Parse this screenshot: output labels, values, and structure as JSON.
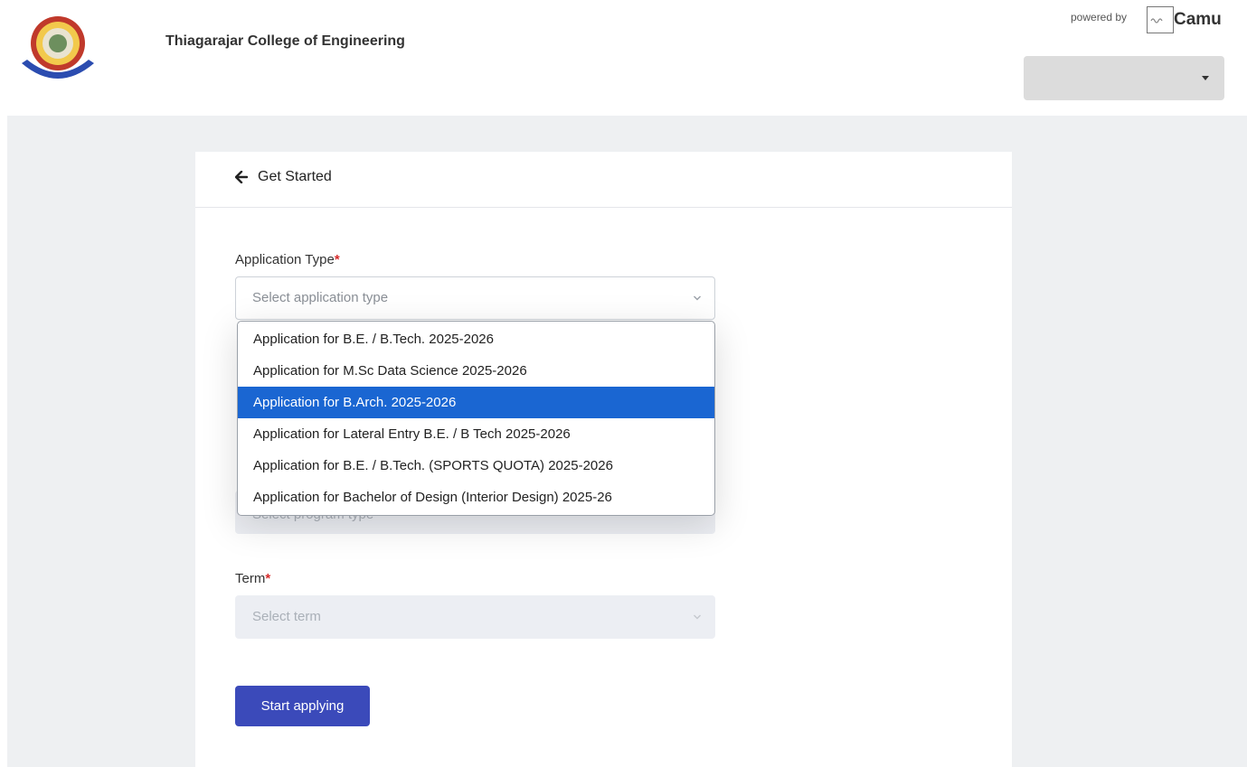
{
  "header": {
    "college_name": "Thiagarajar College of Engineering",
    "logo_icon": "college-emblem-icon",
    "powered_by": "powered by",
    "brand": "Camu",
    "brand_icon": "mycamu-logo-icon",
    "language_select": {
      "value": "",
      "icon": "caret-down-icon"
    }
  },
  "page": {
    "back_icon": "arrow-left-icon",
    "back_label": "Get Started"
  },
  "form": {
    "application_type": {
      "label": "Application Type",
      "required_mark": "*",
      "placeholder": "Select application type",
      "options": [
        "Application for B.E. / B.Tech. 2025-2026",
        "Application for M.Sc Data Science 2025-2026",
        "Application for B.Arch. 2025-2026",
        "Application for Lateral Entry B.E. / B Tech 2025-2026",
        "Application for B.E. / B.Tech. (SPORTS QUOTA) 2025-2026",
        "Application for Bachelor of Design (Interior Design) 2025-26"
      ],
      "highlighted_option": "Application for B.Arch. 2025-2026"
    },
    "program_type": {
      "placeholder": "Select program type"
    },
    "term": {
      "label": "Term",
      "required_mark": "*",
      "placeholder": "Select term"
    },
    "submit_label": "Start applying"
  },
  "colors": {
    "primary_button": "#3b4aba",
    "highlight": "#1a66d2",
    "required": "#d62b2b",
    "page_bg": "#eef0f2"
  }
}
